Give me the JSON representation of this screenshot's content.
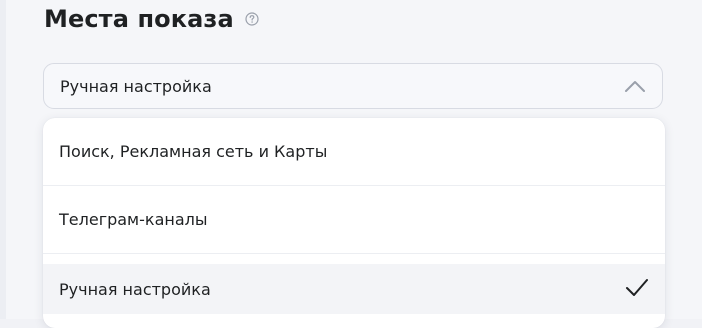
{
  "section": {
    "title": "Места показа",
    "help_icon": "question-circle-icon"
  },
  "select": {
    "value": "Ручная настройка",
    "expanded": true,
    "chevron_icon": "chevron-up-icon"
  },
  "dropdown": {
    "options": [
      {
        "label": "Поиск, Рекламная сеть и Карты",
        "selected": false
      },
      {
        "label": "Телеграм-каналы",
        "selected": false
      },
      {
        "label": "Ручная настройка",
        "selected": true
      }
    ],
    "check_icon": "checkmark-icon"
  },
  "colors": {
    "text": "#1f2123",
    "muted_icon": "#9aa0ab",
    "border": "#d8dbe3",
    "selected_bg": "#f3f4f7"
  }
}
